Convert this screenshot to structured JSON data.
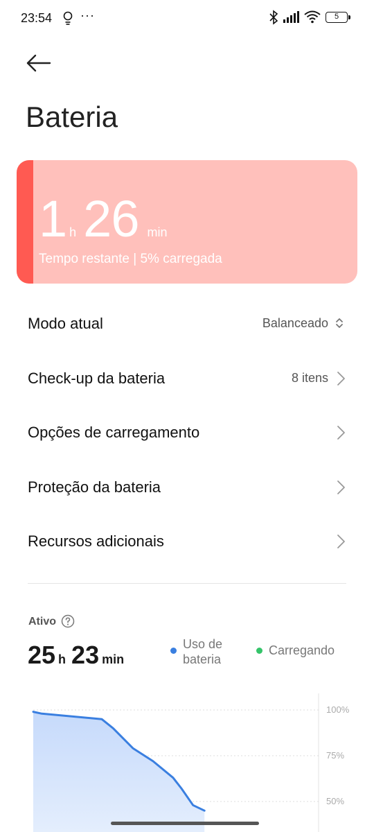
{
  "status_bar": {
    "time": "23:54",
    "dots": "···",
    "battery_level": "5",
    "icons": [
      "location-bulb-icon",
      "bluetooth-icon",
      "signal-icon",
      "wifi-icon",
      "battery-icon"
    ]
  },
  "header": {
    "back_icon": "arrow-left-icon",
    "title": "Bateria"
  },
  "battery_card": {
    "hours": "1",
    "hours_unit": "h",
    "minutes": "26",
    "minutes_unit": "min",
    "subtitle": "Tempo restante | 5% carregada",
    "level_fraction": 0.05,
    "bg_color": "#ffc0bb",
    "fill_color": "#ff5a52"
  },
  "settings": {
    "items": [
      {
        "label": "Modo atual",
        "value": "Balanceado",
        "icon": "up-down-chevron-icon"
      },
      {
        "label": "Check-up da bateria",
        "value": "8 itens",
        "icon": "chevron-right-icon"
      },
      {
        "label": "Opções de carregamento",
        "icon": "chevron-right-icon"
      },
      {
        "label": "Proteção da bateria",
        "icon": "chevron-right-icon"
      },
      {
        "label": "Recursos adicionais",
        "icon": "chevron-right-icon"
      }
    ]
  },
  "active": {
    "label": "Ativo",
    "hours": "25",
    "hours_unit": "h",
    "minutes": "23",
    "minutes_unit": "min",
    "legend": [
      {
        "label": "Uso de bateria",
        "color": "#3a7fe0"
      },
      {
        "label": "Carregando",
        "color": "#35c46a"
      }
    ]
  },
  "chart_data": {
    "type": "area",
    "y_ticks": [
      "100%",
      "75%",
      "50%"
    ],
    "ylim": [
      0,
      100
    ],
    "series": [
      {
        "name": "Uso de bateria",
        "x": [
          0,
          0.03,
          0.24,
          0.28,
          0.35,
          0.42,
          0.49,
          0.52,
          0.56,
          0.6
        ],
        "values": [
          99,
          98,
          95,
          90,
          79,
          72,
          63,
          57,
          48,
          45
        ]
      }
    ],
    "colors": {
      "line": "#3a7fe0",
      "fill": "#cfe0fb"
    },
    "grid": true
  }
}
